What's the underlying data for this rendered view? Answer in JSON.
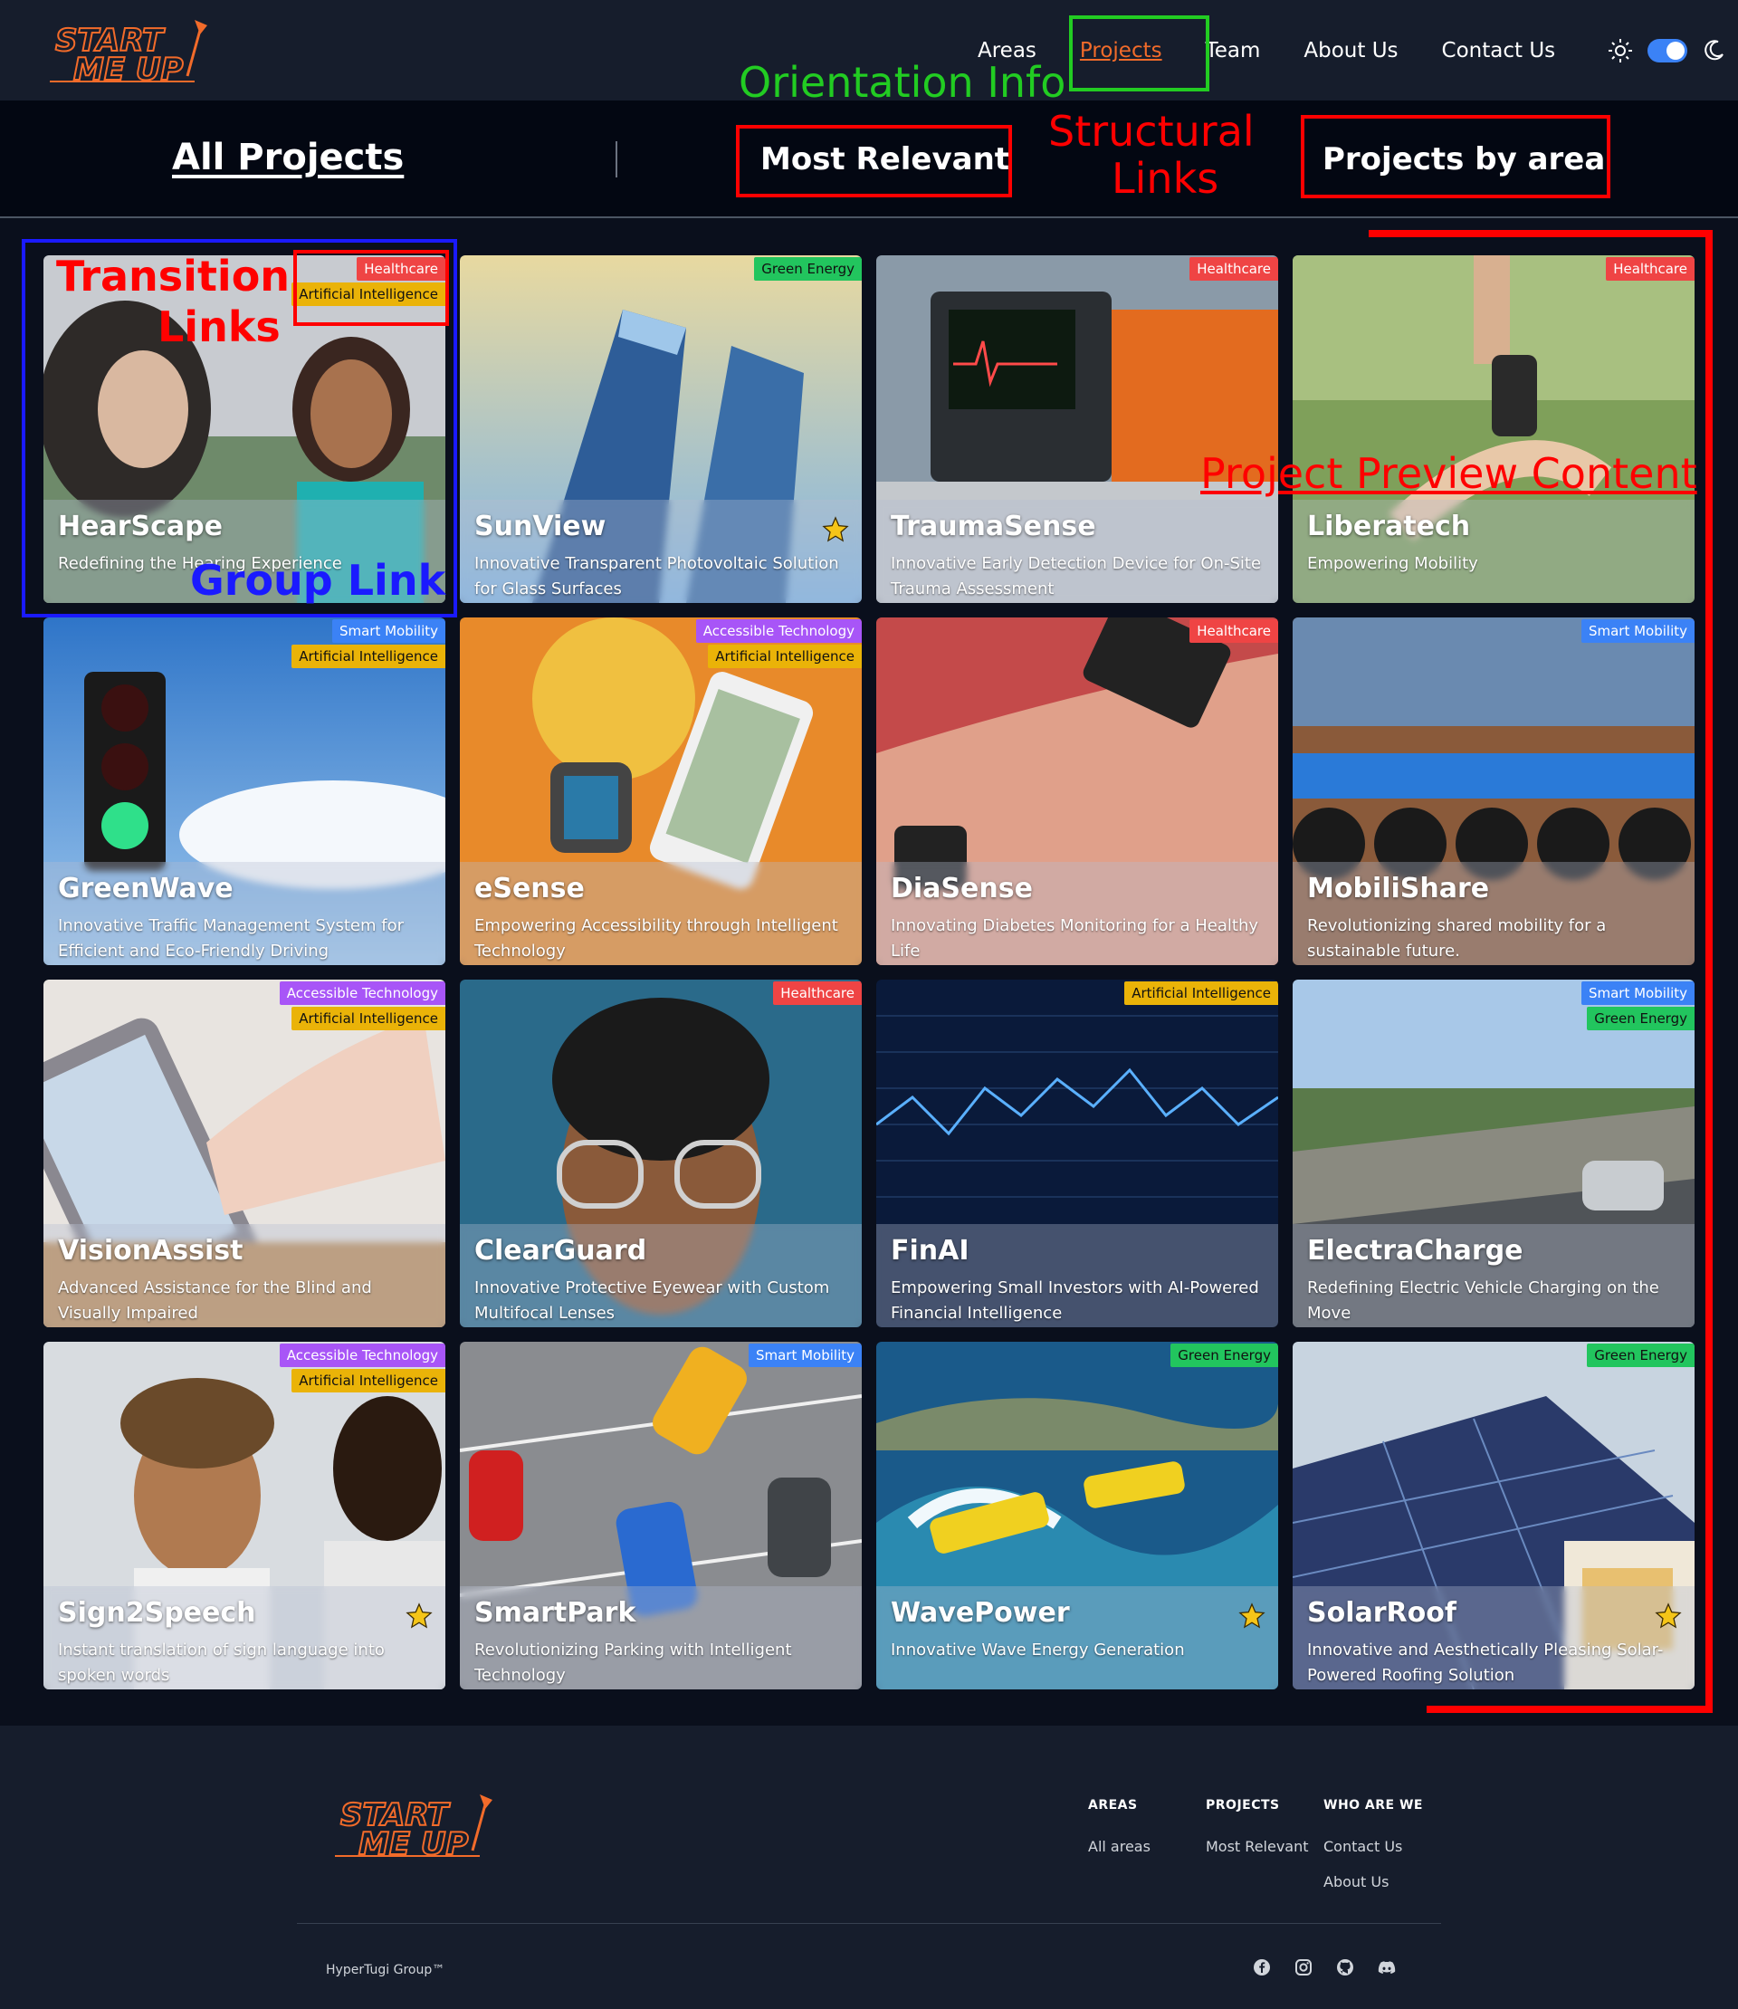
{
  "navbar": {
    "logo_line1": "START",
    "logo_line2": "ME UP",
    "links": [
      "Areas",
      "Projects",
      "Team",
      "About Us",
      "Contact Us"
    ],
    "active": "Projects"
  },
  "subheader": {
    "all_projects": "All Projects",
    "most_relevant": "Most Relevant",
    "projects_by_area": "Projects by area"
  },
  "tag_colors": {
    "Healthcare": "#ef4444",
    "Green Energy": "#22c55e",
    "Artificial Intelligence": "#eab308",
    "Smart Mobility": "#3b82f6",
    "Accessible Technology": "#a855f7"
  },
  "projects": [
    {
      "title": "HearScape",
      "desc": "Redefining the Hearing Experience",
      "tags": [
        "Healthcare",
        "Artificial Intelligence"
      ],
      "starred": false,
      "img": "hearing"
    },
    {
      "title": "SunView",
      "desc": "Innovative Transparent Photovoltaic Solution for Glass Surfaces",
      "tags": [
        "Green Energy"
      ],
      "starred": true,
      "img": "buildings"
    },
    {
      "title": "TraumaSense",
      "desc": "Innovative Early Detection Device for On-Site Trauma Assessment",
      "tags": [
        "Healthcare"
      ],
      "starred": false,
      "img": "monitor"
    },
    {
      "title": "Liberatech",
      "desc": "Empowering Mobility",
      "tags": [
        "Healthcare"
      ],
      "starred": false,
      "img": "prosthetic"
    },
    {
      "title": "GreenWave",
      "desc": "Innovative Traffic Management System for Efficient and Eco-Friendly Driving",
      "tags": [
        "Smart Mobility",
        "Artificial Intelligence"
      ],
      "starred": false,
      "img": "traffic"
    },
    {
      "title": "eSense",
      "desc": "Empowering Accessibility through Intelligent Technology",
      "tags": [
        "Accessible Technology",
        "Artificial Intelligence"
      ],
      "starred": false,
      "img": "watch"
    },
    {
      "title": "DiaSense",
      "desc": "Innovating Diabetes Monitoring for a Healthy Life",
      "tags": [
        "Healthcare"
      ],
      "starred": false,
      "img": "phone-arm"
    },
    {
      "title": "MobiliShare",
      "desc": "Revolutionizing shared mobility for a sustainable future.",
      "tags": [
        "Smart Mobility"
      ],
      "starred": false,
      "img": "bikes"
    },
    {
      "title": "VisionAssist",
      "desc": "Advanced Assistance for the Blind and Visually Impaired",
      "tags": [
        "Accessible Technology",
        "Artificial Intelligence"
      ],
      "starred": false,
      "img": "phone-hand"
    },
    {
      "title": "ClearGuard",
      "desc": "Innovative Protective Eyewear with Custom Multifocal Lenses",
      "tags": [
        "Healthcare"
      ],
      "starred": false,
      "img": "glasses"
    },
    {
      "title": "FinAI",
      "desc": "Empowering Small Investors with AI-Powered Financial Intelligence",
      "tags": [
        "Artificial Intelligence"
      ],
      "starred": false,
      "img": "stocks"
    },
    {
      "title": "ElectraCharge",
      "desc": "Redefining Electric Vehicle Charging on the Move",
      "tags": [
        "Smart Mobility",
        "Green Energy"
      ],
      "starred": false,
      "img": "road"
    },
    {
      "title": "Sign2Speech",
      "desc": "Instant translation of sign language into spoken words",
      "tags": [
        "Accessible Technology",
        "Artificial Intelligence"
      ],
      "starred": true,
      "img": "sign"
    },
    {
      "title": "SmartPark",
      "desc": "Revolutionizing Parking with Intelligent Technology",
      "tags": [
        "Smart Mobility"
      ],
      "starred": false,
      "img": "parking"
    },
    {
      "title": "WavePower",
      "desc": "Innovative Wave Energy Generation",
      "tags": [
        "Green Energy"
      ],
      "starred": true,
      "img": "waves"
    },
    {
      "title": "SolarRoof",
      "desc": "Innovative and Aesthetically Pleasing Solar-Powered Roofing Solution",
      "tags": [
        "Green Energy"
      ],
      "starred": true,
      "img": "solar"
    }
  ],
  "footer": {
    "cols": [
      {
        "head": "AREAS",
        "links": [
          "All areas"
        ]
      },
      {
        "head": "PROJECTS",
        "links": [
          "Most Relevant"
        ]
      },
      {
        "head": "WHO ARE WE",
        "links": [
          "Contact Us",
          "About Us"
        ]
      }
    ],
    "copyright": "HyperTugi Group™",
    "socials": [
      "facebook-icon",
      "instagram-icon",
      "github-icon",
      "discord-icon"
    ]
  },
  "annotations": {
    "orientation_info": "Orientation Info",
    "structural_links_1": "Structural",
    "structural_links_2": "Links",
    "transition_links_1": "Transition",
    "transition_links_2": "Links",
    "group_link": "Group Link",
    "project_preview": "Project Preview Content",
    "colors": {
      "red": "#ff0000",
      "green": "#22cc22",
      "blue": "#1a1aff"
    }
  }
}
